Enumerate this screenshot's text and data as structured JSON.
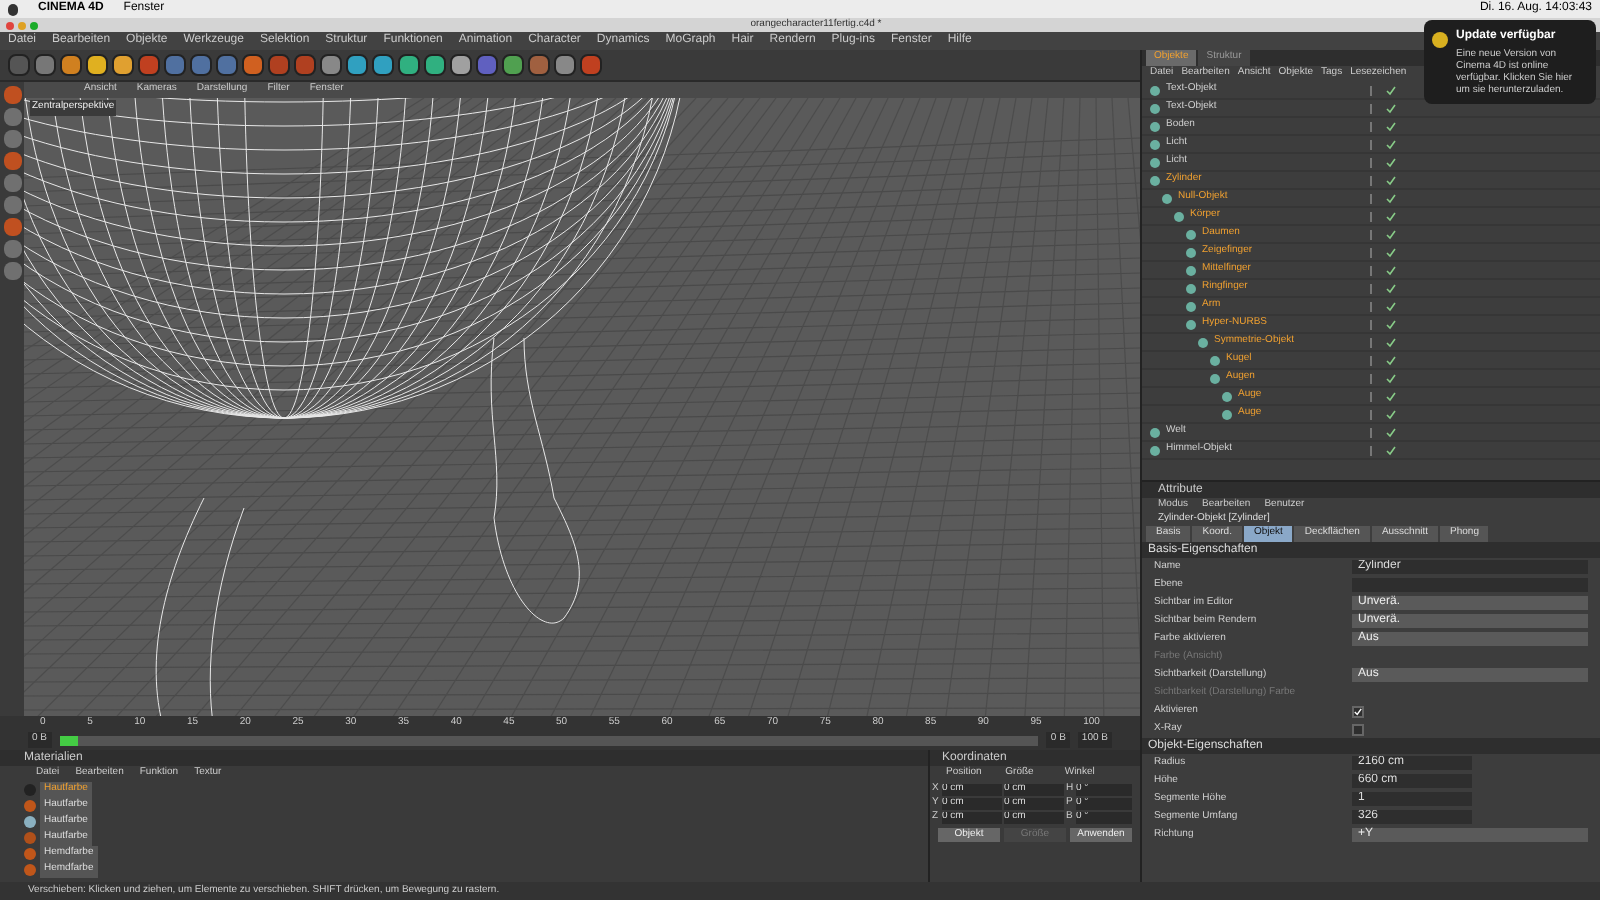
{
  "mac_menu": {
    "app": "CINEMA 4D",
    "items": [
      "Fenster"
    ],
    "clock": "Di. 16. Aug. 14:03:43"
  },
  "window": {
    "title": "orangecharacter11fertig.c4d *"
  },
  "menu": [
    "Datei",
    "Bearbeiten",
    "Objekte",
    "Werkzeuge",
    "Selektion",
    "Struktur",
    "Funktionen",
    "Animation",
    "Character",
    "Dynamics",
    "MoGraph",
    "Hair",
    "Rendern",
    "Plug-ins",
    "Fenster",
    "Hilfe"
  ],
  "viewport": {
    "menu": [
      "Ansicht",
      "Kameras",
      "Darstellung",
      "Filter",
      "Fenster"
    ],
    "label": "Zentralperspektive"
  },
  "timeline": {
    "ticks": [
      "0",
      "5",
      "10",
      "15",
      "20",
      "25",
      "30",
      "35",
      "40",
      "45",
      "50",
      "55",
      "60",
      "65",
      "70",
      "75",
      "80",
      "85",
      "90",
      "95",
      "100"
    ],
    "start": "0 B",
    "end": "100 B",
    "current": "0 B",
    "level": 0.02
  },
  "materials": {
    "title": "Materialien",
    "menu": [
      "Datei",
      "Bearbeiten",
      "Funktion",
      "Textur"
    ],
    "items": [
      {
        "name": "Hautfarbe",
        "selected": true,
        "color": "#222222"
      },
      {
        "name": "Hautfarbe",
        "selected": false,
        "color": "#c0561a"
      },
      {
        "name": "Hautfarbe",
        "selected": false,
        "color": "#8ab0c0"
      },
      {
        "name": "Hautfarbe",
        "selected": false,
        "color": "#b0501a"
      },
      {
        "name": "Hemdfarbe",
        "selected": false,
        "color": "#c0561a"
      },
      {
        "name": "Hemdfarbe",
        "selected": false,
        "color": "#c0561a"
      }
    ]
  },
  "coordinates": {
    "title": "Koordinaten",
    "columns": [
      "Position",
      "Größe",
      "Winkel"
    ],
    "rows": [
      {
        "axis": "X",
        "position": "0 cm",
        "size": "0 cm",
        "angle_axis": "H",
        "angle": "0 °"
      },
      {
        "axis": "Y",
        "position": "0 cm",
        "size": "0 cm",
        "angle_axis": "P",
        "angle": "0 °"
      },
      {
        "axis": "Z",
        "position": "0 cm",
        "size": "0 cm",
        "angle_axis": "B",
        "angle": "0 °"
      }
    ],
    "buttons": [
      {
        "label": "Objekt",
        "disabled": false
      },
      {
        "label": "Größe",
        "disabled": true
      },
      {
        "label": "Anwenden",
        "disabled": false
      }
    ]
  },
  "object_manager": {
    "tabs": [
      {
        "label": "Objekte",
        "selected": true
      },
      {
        "label": "Struktur",
        "selected": false
      }
    ],
    "menu": [
      "Datei",
      "Bearbeiten",
      "Ansicht",
      "Objekte",
      "Tags",
      "Lesezeichen"
    ],
    "tree": [
      {
        "name": "Text-Objekt",
        "selected": false
      },
      {
        "name": "Text-Objekt",
        "selected": false
      },
      {
        "name": "Boden",
        "selected": false
      },
      {
        "name": "Licht",
        "selected": false
      },
      {
        "name": "Licht",
        "selected": false
      },
      {
        "name": "Zylinder",
        "selected": true,
        "children": [
          {
            "name": "Null-Objekt",
            "selected": true,
            "children": [
              {
                "name": "Körper",
                "selected": true,
                "children": [
                  {
                    "name": "Daumen",
                    "selected": true
                  },
                  {
                    "name": "Zeigefinger",
                    "selected": true
                  },
                  {
                    "name": "Mittelfinger",
                    "selected": true
                  },
                  {
                    "name": "Ringfinger",
                    "selected": true
                  },
                  {
                    "name": "Arm",
                    "selected": true
                  },
                  {
                    "name": "Hyper-NURBS",
                    "selected": true,
                    "children": [
                      {
                        "name": "Symmetrie-Objekt",
                        "selected": true,
                        "children": [
                          {
                            "name": "Kugel",
                            "selected": true
                          },
                          {
                            "name": "Augen",
                            "selected": true,
                            "children": [
                              {
                                "name": "Auge",
                                "selected": true
                              },
                              {
                                "name": "Auge",
                                "selected": true
                              }
                            ]
                          }
                        ]
                      }
                    ]
                  }
                ]
              }
            ]
          }
        ]
      },
      {
        "name": "Welt",
        "selected": false
      },
      {
        "name": "Himmel-Objekt",
        "selected": false
      }
    ]
  },
  "attributes": {
    "title": "Attribute",
    "menu": [
      "Modus",
      "Bearbeiten",
      "Benutzer"
    ],
    "object": "Zylinder-Objekt [Zylinder]",
    "tabs": [
      {
        "label": "Basis",
        "selected": false
      },
      {
        "label": "Koord.",
        "selected": false
      },
      {
        "label": "Objekt",
        "selected": true
      },
      {
        "label": "Deckflächen",
        "selected": false
      },
      {
        "label": "Ausschnitt",
        "selected": false
      },
      {
        "label": "Phong",
        "selected": false
      }
    ],
    "sections": [
      {
        "title": "Basis-Eigenschaften",
        "fields": [
          {
            "kind": "text",
            "label": "Name",
            "value": "Zylinder"
          },
          {
            "kind": "text",
            "label": "Ebene"
          },
          {
            "kind": "select",
            "label": "Sichtbar im Editor",
            "value": "Unverä."
          },
          {
            "kind": "select",
            "label": "Sichtbar beim Rendern",
            "value": "Unverä."
          },
          {
            "kind": "select",
            "label": "Farbe aktivieren",
            "value": "Aus"
          },
          {
            "kind": "label",
            "label": "Farbe (Ansicht)",
            "disabled": true
          },
          {
            "kind": "select",
            "label": "Sichtbarkeit (Darstellung)",
            "value": "Aus"
          },
          {
            "kind": "label",
            "label": "Sichtbarkeit (Darstellung) Farbe",
            "disabled": true
          },
          {
            "kind": "check",
            "label": "Aktivieren",
            "checked": true
          },
          {
            "kind": "check",
            "label": "X-Ray",
            "checked": false
          }
        ]
      },
      {
        "title": "Objekt-Eigenschaften",
        "fields": [
          {
            "kind": "number",
            "label": "Radius",
            "value": "2160 cm"
          },
          {
            "kind": "number",
            "label": "Höhe",
            "value": "660 cm"
          },
          {
            "kind": "number",
            "label": "Segmente Höhe",
            "value": "1"
          },
          {
            "kind": "number",
            "label": "Segmente Umfang",
            "value": "326"
          },
          {
            "kind": "select",
            "label": "Richtung",
            "value": "+Y"
          }
        ]
      }
    ]
  },
  "status_bar": "Verschieben: Klicken und ziehen, um Elemente zu verschieben. SHIFT drücken, um Bewegung zu rastern.",
  "notification": {
    "title": "Update verfügbar",
    "text": "Eine neue Version von Cinema 4D ist online verfügbar. Klicken Sie hier um sie herunterzuladen."
  }
}
